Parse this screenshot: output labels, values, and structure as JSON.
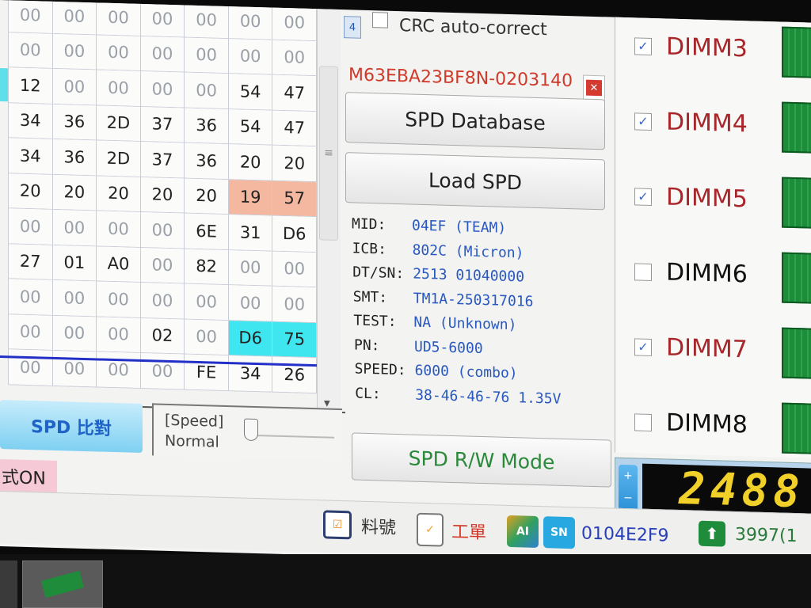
{
  "hex_grid": {
    "rows": [
      [
        "00",
        "00",
        "00",
        "00",
        "00",
        "00",
        "00"
      ],
      [
        "00",
        "00",
        "00",
        "00",
        "00",
        "00",
        "00"
      ],
      [
        "12",
        "00",
        "00",
        "00",
        "00",
        "54",
        "47"
      ],
      [
        "34",
        "36",
        "2D",
        "37",
        "36",
        "54",
        "47"
      ],
      [
        "34",
        "36",
        "2D",
        "37",
        "36",
        "20",
        "20"
      ],
      [
        "20",
        "20",
        "20",
        "20",
        "20",
        "19",
        "57"
      ],
      [
        "00",
        "00",
        "00",
        "00",
        "6E",
        "31",
        "D6"
      ],
      [
        "27",
        "01",
        "A0",
        "00",
        "82",
        "00",
        "00"
      ],
      [
        "00",
        "00",
        "00",
        "00",
        "00",
        "00",
        "00"
      ],
      [
        "00",
        "00",
        "00",
        "02",
        "00",
        "D6",
        "75"
      ],
      [
        "00",
        "00",
        "00",
        "00",
        "FE",
        "34",
        "26"
      ]
    ],
    "highlight_orange": [
      [
        5,
        5
      ],
      [
        5,
        6
      ]
    ],
    "highlight_cyan": [
      [
        9,
        5
      ],
      [
        9,
        6
      ]
    ]
  },
  "scrollbar": {
    "grip": "≡",
    "down": "▼"
  },
  "left_controls": {
    "compare_button": "SPD 比對",
    "speed_label": "[Speed]",
    "speed_value": "Normal",
    "mode_badge": "式ON"
  },
  "right_panel": {
    "slot_number": "4",
    "crc_label": "CRC auto-correct",
    "part_number": "M63EBA23BF8N-0203140",
    "clear_icon": "✕",
    "spd_database_button": "SPD Database",
    "load_spd_button": "Load SPD",
    "info": [
      {
        "key": "MID:",
        "value": "04EF (TEAM)"
      },
      {
        "key": "ICB:",
        "value": "802C (Micron)"
      },
      {
        "key": "DT/SN:",
        "value": "2513 01040000"
      },
      {
        "key": "SMT:",
        "value": "TM1A-250317016"
      },
      {
        "key": "TEST:",
        "value": "NA (Unknown)"
      },
      {
        "key": "PN:",
        "value": "UD5-6000"
      },
      {
        "key": "SPEED:",
        "value": "6000 (combo)"
      },
      {
        "key": "CL:",
        "value": "38-46-46-76 1.35V"
      }
    ],
    "rw_mode_button": "SPD R/W Mode"
  },
  "dimms": [
    {
      "label": "DIMM3",
      "checked": true
    },
    {
      "label": "DIMM4",
      "checked": true
    },
    {
      "label": "DIMM5",
      "checked": true
    },
    {
      "label": "DIMM6",
      "checked": false
    },
    {
      "label": "DIMM7",
      "checked": true
    },
    {
      "label": "DIMM8",
      "checked": false
    }
  ],
  "counter": {
    "value": "2488",
    "spin_up": "+",
    "spin_down": "−"
  },
  "status_bar": {
    "material_label": "料號",
    "work_order_label": "工單",
    "ai_badge": "AI",
    "sn_badge": "SN",
    "sn_value": "0104E2F9",
    "count": "3997(1"
  },
  "colors": {
    "accent_blue": "#2858c0",
    "dimm_on": "#a8262a",
    "orange": "#f4b79f",
    "cyan": "#3fe6ef",
    "segment": "#f2d02a"
  }
}
